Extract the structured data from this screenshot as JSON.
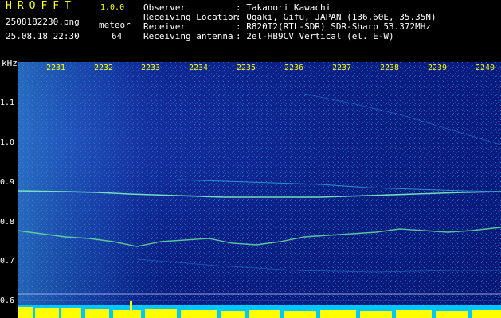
{
  "header": {
    "app_title": "HROFFT",
    "app_version": "1.0.0",
    "file_name": "2508182230.png",
    "date_time": "25.08.18 22:30",
    "meteor_label": "meteor",
    "meteor_count": "64",
    "info": [
      {
        "key": "Observer",
        "value": ": Takanori Kawachi"
      },
      {
        "key": "Receiving Location",
        "value": ": Ogaki, Gifu, JAPAN (136.60E, 35.35N)"
      },
      {
        "key": "Receiver",
        "value": ": R820T2(RTL-SDR) SDR-Sharp 53.372MHz"
      },
      {
        "key": "Receiving antenna",
        "value": ": 2el-HB9CV Vertical (el. E-W)"
      }
    ]
  },
  "spectrogram": {
    "y_unit": "kHz",
    "y_ticks": [
      "1.1",
      "1.0",
      "0.9",
      "0.8",
      "0.7",
      "0.6"
    ],
    "x_ticks": [
      "2231",
      "2232",
      "2233",
      "2234",
      "2235",
      "2236",
      "2237",
      "2238",
      "2239",
      "2240"
    ],
    "colors": {
      "background": "#0b1f86",
      "signal": "#33e0e0",
      "bright": "#ffff00",
      "label_yellow": "#ffff00",
      "label_white": "#ffffff"
    }
  }
}
